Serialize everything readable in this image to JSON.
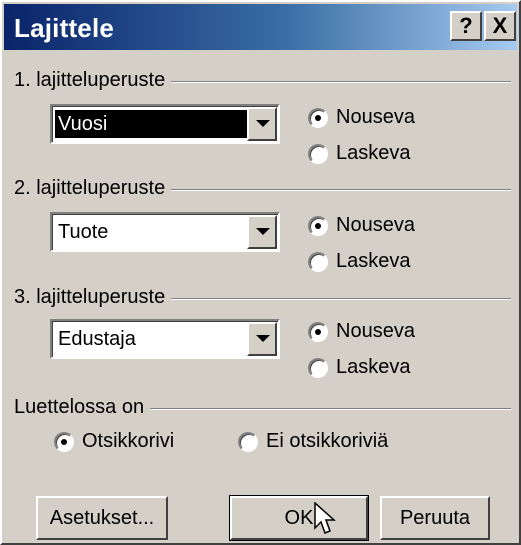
{
  "window": {
    "title": "Lajittele",
    "help_label": "?",
    "close_label": "X"
  },
  "groups": [
    {
      "label": "1. lajitteluperuste",
      "value": "Vuosi",
      "options": [
        "Nouseva",
        "Laskeva"
      ],
      "selected": 0
    },
    {
      "label": "2. lajitteluperuste",
      "value": "Tuote",
      "options": [
        "Nouseva",
        "Laskeva"
      ],
      "selected": 0
    },
    {
      "label": "3. lajitteluperuste",
      "value": "Edustaja",
      "options": [
        "Nouseva",
        "Laskeva"
      ],
      "selected": 0
    }
  ],
  "list_header": {
    "label": "Luettelossa on",
    "options": [
      "Otsikkorivi",
      "Ei otsikkoriviä"
    ],
    "selected": 0
  },
  "buttons": {
    "options": "Asetukset...",
    "ok": "OK",
    "cancel": "Peruuta"
  }
}
